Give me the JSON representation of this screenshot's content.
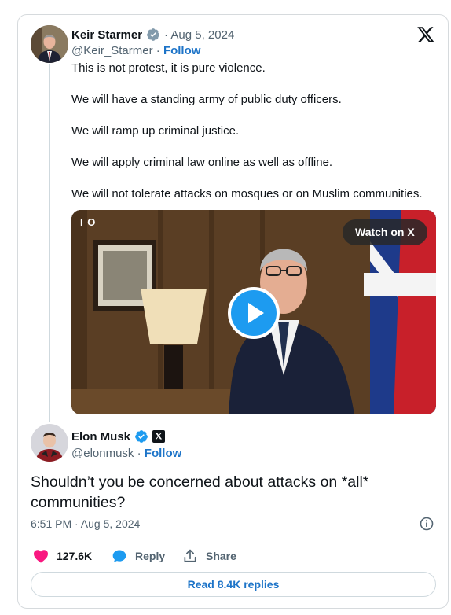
{
  "original_post": {
    "author_name": "Keir Starmer",
    "date": "· Aug 5, 2024",
    "handle": "@Keir_Starmer",
    "separator": " · ",
    "follow_label": "Follow",
    "paragraphs": [
      "This is not protest, it is pure violence.",
      "We will have a standing army of public duty officers.",
      "We will ramp up criminal justice.",
      "We will apply criminal law online as well as offline.",
      "We will not tolerate attacks on mosques or on Muslim communities."
    ],
    "video": {
      "watch_label": "Watch on X",
      "overlay_mark": "I O"
    }
  },
  "reply_post": {
    "author_name": "Elon Musk",
    "handle": "@elonmusk",
    "separator": " · ",
    "follow_label": "Follow",
    "text": "Shouldn’t you be concerned about attacks on *all* communities?",
    "timestamp": "6:51 PM · Aug 5, 2024"
  },
  "actions": {
    "like_count": "127.6K",
    "reply_label": "Reply",
    "share_label": "Share",
    "read_replies_label": "Read 8.4K replies"
  },
  "colors": {
    "accent": "#1d74c8",
    "verified": "#1d9bf0",
    "like": "#f91880",
    "muted": "#536471"
  }
}
